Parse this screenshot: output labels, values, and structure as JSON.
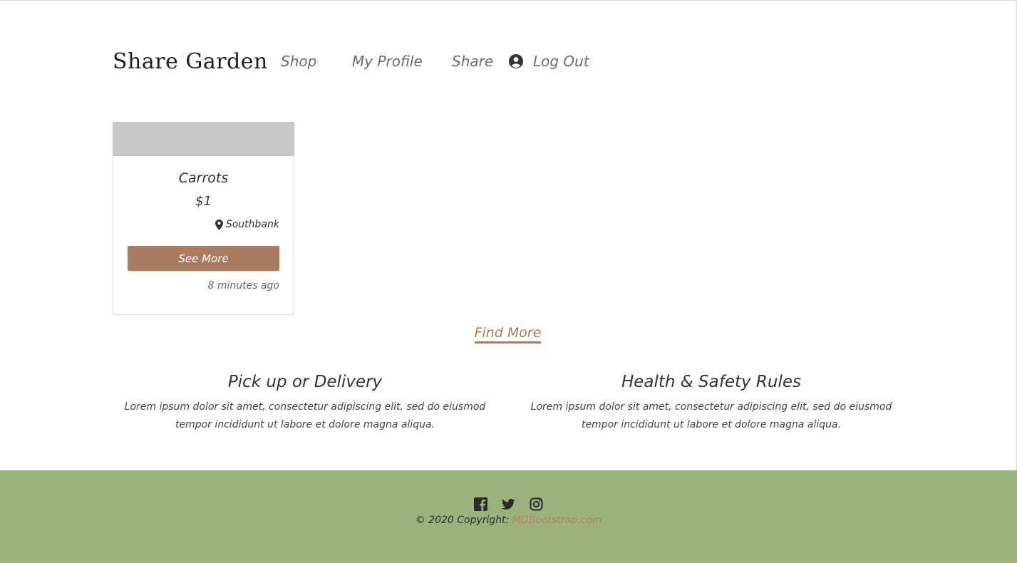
{
  "navbar": {
    "brand": "Share Garden",
    "links": {
      "shop": "Shop",
      "profile": "My Profile",
      "share": "Share",
      "logout": "Log Out"
    }
  },
  "card": {
    "title": "Carrots",
    "price": "$1",
    "location": "Southbank",
    "button": "See More",
    "time": "8 minutes ago"
  },
  "find_more": "Find More",
  "features": [
    {
      "title": "Pick up or Delivery",
      "text": "Lorem ipsum dolor sit amet, consectetur adipiscing elit, sed do eiusmod tempor incididunt ut labore et dolore magna aliqua."
    },
    {
      "title": "Health & Safety Rules",
      "text": "Lorem ipsum dolor sit amet, consectetur adipiscing elit, sed do eiusmod tempor incididunt ut labore et dolore magna aliqua."
    }
  ],
  "footer": {
    "social_icons": [
      "facebook-icon",
      "twitter-icon",
      "instagram-icon"
    ],
    "copyright": "© 2020 Copyright:",
    "link": "MDBootstrap.com"
  },
  "colors": {
    "accent": "#a97c62",
    "footer_bg": "#9bb27c",
    "card_image": "#c8c8c8"
  }
}
